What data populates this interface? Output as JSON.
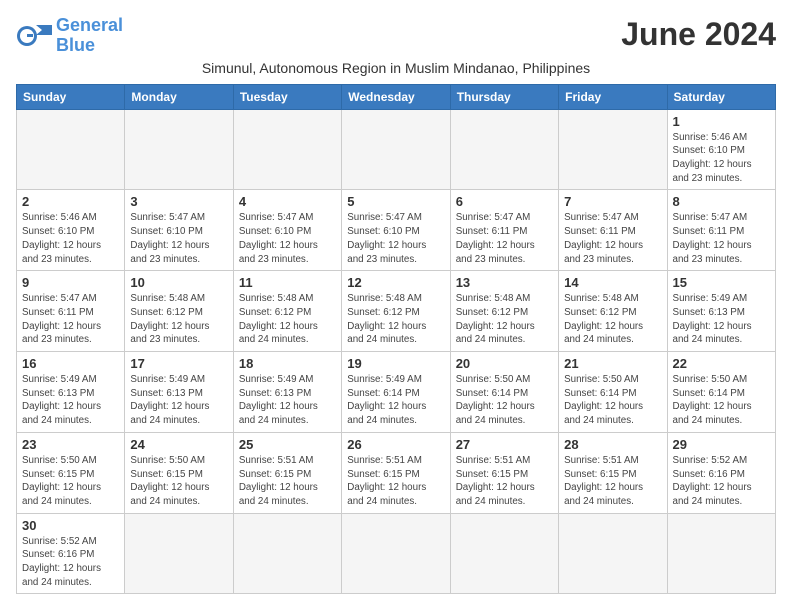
{
  "logo": {
    "text_general": "General",
    "text_blue": "Blue"
  },
  "header": {
    "month_title": "June 2024",
    "subtitle": "Simunul, Autonomous Region in Muslim Mindanao, Philippines"
  },
  "weekdays": [
    "Sunday",
    "Monday",
    "Tuesday",
    "Wednesday",
    "Thursday",
    "Friday",
    "Saturday"
  ],
  "weeks": [
    [
      {
        "day": "",
        "info": ""
      },
      {
        "day": "",
        "info": ""
      },
      {
        "day": "",
        "info": ""
      },
      {
        "day": "",
        "info": ""
      },
      {
        "day": "",
        "info": ""
      },
      {
        "day": "",
        "info": ""
      },
      {
        "day": "1",
        "info": "Sunrise: 5:46 AM\nSunset: 6:10 PM\nDaylight: 12 hours and 23 minutes."
      }
    ],
    [
      {
        "day": "2",
        "info": "Sunrise: 5:46 AM\nSunset: 6:10 PM\nDaylight: 12 hours and 23 minutes."
      },
      {
        "day": "3",
        "info": "Sunrise: 5:47 AM\nSunset: 6:10 PM\nDaylight: 12 hours and 23 minutes."
      },
      {
        "day": "4",
        "info": "Sunrise: 5:47 AM\nSunset: 6:10 PM\nDaylight: 12 hours and 23 minutes."
      },
      {
        "day": "5",
        "info": "Sunrise: 5:47 AM\nSunset: 6:10 PM\nDaylight: 12 hours and 23 minutes."
      },
      {
        "day": "6",
        "info": "Sunrise: 5:47 AM\nSunset: 6:11 PM\nDaylight: 12 hours and 23 minutes."
      },
      {
        "day": "7",
        "info": "Sunrise: 5:47 AM\nSunset: 6:11 PM\nDaylight: 12 hours and 23 minutes."
      },
      {
        "day": "8",
        "info": "Sunrise: 5:47 AM\nSunset: 6:11 PM\nDaylight: 12 hours and 23 minutes."
      }
    ],
    [
      {
        "day": "9",
        "info": "Sunrise: 5:47 AM\nSunset: 6:11 PM\nDaylight: 12 hours and 23 minutes."
      },
      {
        "day": "10",
        "info": "Sunrise: 5:48 AM\nSunset: 6:12 PM\nDaylight: 12 hours and 23 minutes."
      },
      {
        "day": "11",
        "info": "Sunrise: 5:48 AM\nSunset: 6:12 PM\nDaylight: 12 hours and 24 minutes."
      },
      {
        "day": "12",
        "info": "Sunrise: 5:48 AM\nSunset: 6:12 PM\nDaylight: 12 hours and 24 minutes."
      },
      {
        "day": "13",
        "info": "Sunrise: 5:48 AM\nSunset: 6:12 PM\nDaylight: 12 hours and 24 minutes."
      },
      {
        "day": "14",
        "info": "Sunrise: 5:48 AM\nSunset: 6:12 PM\nDaylight: 12 hours and 24 minutes."
      },
      {
        "day": "15",
        "info": "Sunrise: 5:49 AM\nSunset: 6:13 PM\nDaylight: 12 hours and 24 minutes."
      }
    ],
    [
      {
        "day": "16",
        "info": "Sunrise: 5:49 AM\nSunset: 6:13 PM\nDaylight: 12 hours and 24 minutes."
      },
      {
        "day": "17",
        "info": "Sunrise: 5:49 AM\nSunset: 6:13 PM\nDaylight: 12 hours and 24 minutes."
      },
      {
        "day": "18",
        "info": "Sunrise: 5:49 AM\nSunset: 6:13 PM\nDaylight: 12 hours and 24 minutes."
      },
      {
        "day": "19",
        "info": "Sunrise: 5:49 AM\nSunset: 6:14 PM\nDaylight: 12 hours and 24 minutes."
      },
      {
        "day": "20",
        "info": "Sunrise: 5:50 AM\nSunset: 6:14 PM\nDaylight: 12 hours and 24 minutes."
      },
      {
        "day": "21",
        "info": "Sunrise: 5:50 AM\nSunset: 6:14 PM\nDaylight: 12 hours and 24 minutes."
      },
      {
        "day": "22",
        "info": "Sunrise: 5:50 AM\nSunset: 6:14 PM\nDaylight: 12 hours and 24 minutes."
      }
    ],
    [
      {
        "day": "23",
        "info": "Sunrise: 5:50 AM\nSunset: 6:15 PM\nDaylight: 12 hours and 24 minutes."
      },
      {
        "day": "24",
        "info": "Sunrise: 5:50 AM\nSunset: 6:15 PM\nDaylight: 12 hours and 24 minutes."
      },
      {
        "day": "25",
        "info": "Sunrise: 5:51 AM\nSunset: 6:15 PM\nDaylight: 12 hours and 24 minutes."
      },
      {
        "day": "26",
        "info": "Sunrise: 5:51 AM\nSunset: 6:15 PM\nDaylight: 12 hours and 24 minutes."
      },
      {
        "day": "27",
        "info": "Sunrise: 5:51 AM\nSunset: 6:15 PM\nDaylight: 12 hours and 24 minutes."
      },
      {
        "day": "28",
        "info": "Sunrise: 5:51 AM\nSunset: 6:15 PM\nDaylight: 12 hours and 24 minutes."
      },
      {
        "day": "29",
        "info": "Sunrise: 5:52 AM\nSunset: 6:16 PM\nDaylight: 12 hours and 24 minutes."
      }
    ],
    [
      {
        "day": "30",
        "info": "Sunrise: 5:52 AM\nSunset: 6:16 PM\nDaylight: 12 hours and 24 minutes."
      },
      {
        "day": "",
        "info": ""
      },
      {
        "day": "",
        "info": ""
      },
      {
        "day": "",
        "info": ""
      },
      {
        "day": "",
        "info": ""
      },
      {
        "day": "",
        "info": ""
      },
      {
        "day": "",
        "info": ""
      }
    ]
  ]
}
